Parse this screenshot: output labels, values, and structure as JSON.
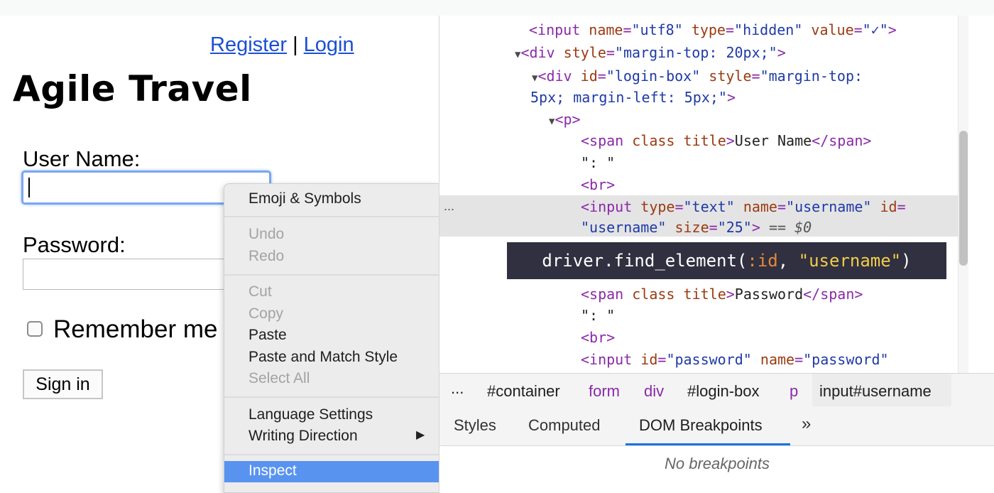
{
  "page": {
    "register_link": "Register",
    "separator": "|",
    "login_link": "Login",
    "title": "Agile Travel",
    "username_label": "User Name:",
    "username_value": "",
    "password_label": "Password:",
    "password_value": "",
    "remember_label": "Remember me",
    "signin_label": "Sign in"
  },
  "context_menu": {
    "emoji": "Emoji & Symbols",
    "undo": "Undo",
    "redo": "Redo",
    "cut": "Cut",
    "copy": "Copy",
    "paste": "Paste",
    "paste_match": "Paste and Match Style",
    "select_all": "Select All",
    "language": "Language Settings",
    "writing": "Writing Direction",
    "inspect": "Inspect"
  },
  "devtools": {
    "tooltip_method": "driver.find_element(",
    "tooltip_symbol": ":id",
    "tooltip_sep": ", ",
    "tooltip_string": "\"username\"",
    "tooltip_close": ")",
    "selected_marker": "== $0",
    "row_ellipsis": "...",
    "breadcrumbs": {
      "ellipsis": "...",
      "container": "#container",
      "form": "form",
      "div": "div",
      "login_box": "#login-box",
      "p": "p",
      "input": "input#username"
    },
    "tabs": {
      "styles": "Styles",
      "computed": "Computed",
      "dom_breakpoints": "DOM Breakpoints",
      "more": "»"
    },
    "no_breakpoints": "No breakpoints"
  },
  "colors": {
    "link": "#1a4fd6",
    "menu_highlight": "#5993f0",
    "tooltip_bg": "#303040",
    "tab_underline": "#1a73e8",
    "tag": "#8a2aa8",
    "attr_value": "#1f3aa7"
  }
}
